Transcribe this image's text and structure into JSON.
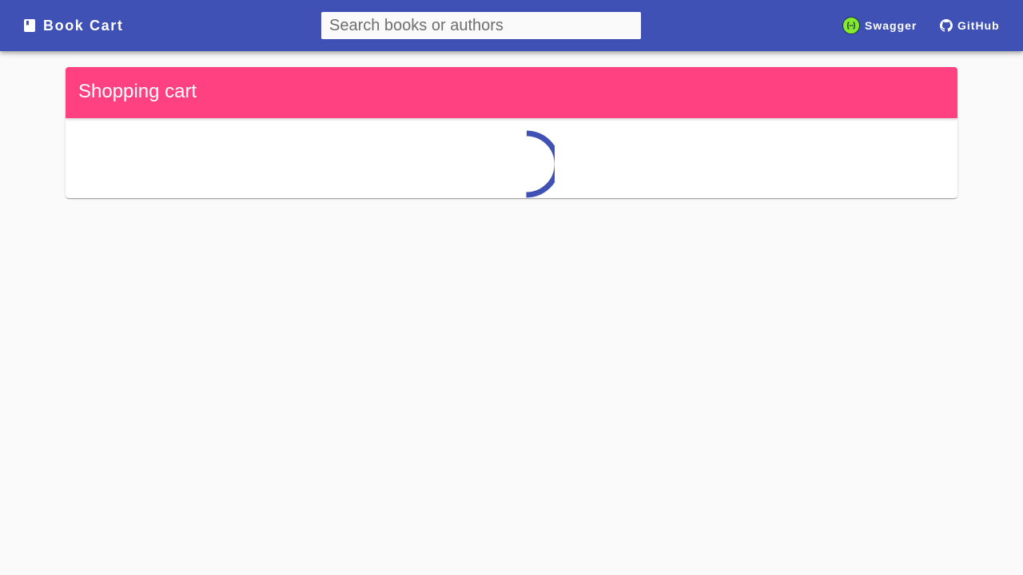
{
  "toolbar": {
    "brand": {
      "label": "Book Cart",
      "icon": "book-icon"
    },
    "search": {
      "placeholder": "Search books or authors",
      "value": ""
    },
    "links": [
      {
        "label": "Swagger",
        "icon": "swagger-icon",
        "icon_color": "#85ea2d"
      },
      {
        "label": "GitHub",
        "icon": "github-icon"
      }
    ]
  },
  "cart": {
    "title": "Shopping cart",
    "loading": true,
    "spinner_icon": "loading-spinner-icon"
  },
  "colors": {
    "primary": "#3f51b5",
    "accent": "#ff4081",
    "background": "#fafafa"
  }
}
